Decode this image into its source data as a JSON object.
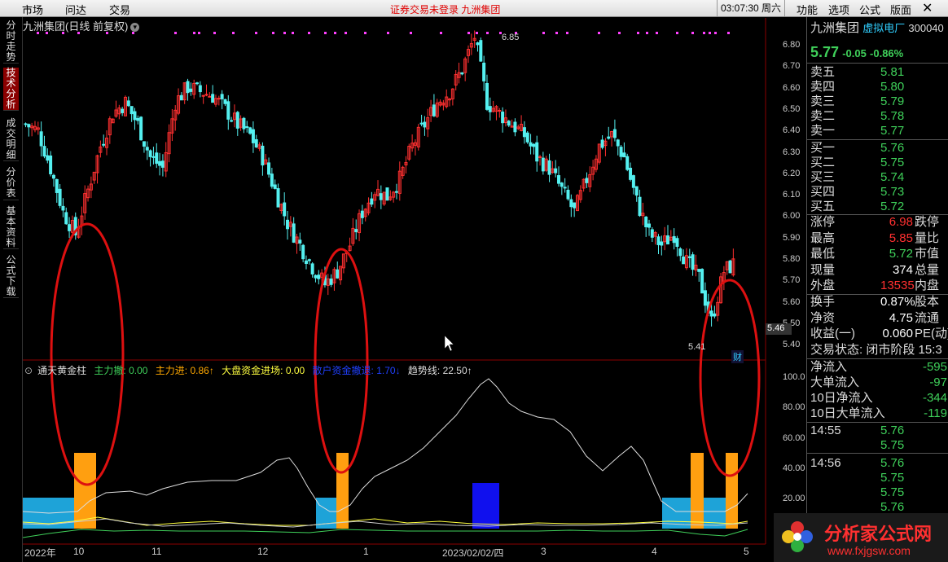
{
  "menu": {
    "items": [
      "市场",
      "问达",
      "交易"
    ],
    "title": "证券交易未登录  九洲集团",
    "clock": "03:07:30 周六",
    "right_items": [
      "功能",
      "选项",
      "公式",
      "版面"
    ],
    "close": "✕"
  },
  "left_tabs": [
    "分时走势",
    "技术分析",
    "成交明细",
    "分价表",
    "基本资料",
    "公式下载"
  ],
  "chart": {
    "title": "九洲集团(日线 前复权)",
    "price_ticks": [
      "6.80",
      "6.70",
      "6.60",
      "6.50",
      "6.40",
      "6.30",
      "6.20",
      "6.10",
      "6.00",
      "5.90",
      "5.80",
      "5.70",
      "5.60",
      "5.50",
      "5.40"
    ],
    "current_price_label": "5.46",
    "high_marker": "6.85",
    "low_marker": "5.41",
    "fin_badge": "财",
    "indicator_ticks": [
      "100.0",
      "80.00",
      "60.00",
      "40.00",
      "20.00"
    ],
    "time_ticks": [
      "2022年",
      "10",
      "11",
      "12",
      "1",
      "2023/02/02/四",
      "3",
      "4",
      "5"
    ]
  },
  "indicator": {
    "name": "通天黄金柱",
    "items": [
      {
        "label": "主力撤: 0.00",
        "color": "#3fd05a"
      },
      {
        "label": "主力进: 0.86↑",
        "color": "#ffa800"
      },
      {
        "label": "大盘资金进场: 0.00",
        "color": "#ffff40"
      },
      {
        "label": "散户资金撤退: 1.70↓",
        "color": "#2040ff"
      },
      {
        "label": "趋势线: 22.50↑",
        "color": "#dddddd"
      }
    ]
  },
  "chart_data": {
    "type": "candlestick",
    "price_ylim": [
      5.4,
      6.85
    ],
    "indicator_ylim": [
      0,
      100
    ],
    "candles_approx_close": [
      6.45,
      6.42,
      6.25,
      6.05,
      5.95,
      6.15,
      6.35,
      6.5,
      6.55,
      6.45,
      6.3,
      6.25,
      6.55,
      6.62,
      6.6,
      6.58,
      6.52,
      6.45,
      6.4,
      6.3,
      6.15,
      6.0,
      5.9,
      5.8,
      5.72,
      5.78,
      5.9,
      6.05,
      6.15,
      6.12,
      6.2,
      6.35,
      6.45,
      6.55,
      6.6,
      6.7,
      6.85,
      6.55,
      6.5,
      6.45,
      6.4,
      6.3,
      6.25,
      6.15,
      6.05,
      6.2,
      6.35,
      6.4,
      6.3,
      6.1,
      5.95,
      5.9,
      5.95,
      5.82,
      5.75,
      5.55,
      5.78,
      5.82
    ]
  },
  "quote": {
    "name": "九洲集团",
    "tag": "虚拟电厂",
    "code": "300040",
    "price": "5.77",
    "change": "-0.05",
    "change_pct": "-0.86%",
    "asks": [
      {
        "label": "卖五",
        "price": "5.81"
      },
      {
        "label": "卖四",
        "price": "5.80"
      },
      {
        "label": "卖三",
        "price": "5.79"
      },
      {
        "label": "卖二",
        "price": "5.78"
      },
      {
        "label": "卖一",
        "price": "5.77"
      }
    ],
    "bids": [
      {
        "label": "买一",
        "price": "5.76"
      },
      {
        "label": "买二",
        "price": "5.75"
      },
      {
        "label": "买三",
        "price": "5.74"
      },
      {
        "label": "买四",
        "price": "5.73"
      },
      {
        "label": "买五",
        "price": "5.72"
      }
    ],
    "stats": [
      {
        "l": "涨停",
        "v": "6.98",
        "r": "跌停",
        "c": "red"
      },
      {
        "l": "最高",
        "v": "5.85",
        "r": "量比",
        "c": "red"
      },
      {
        "l": "最低",
        "v": "5.72",
        "r": "市值",
        "c": "green"
      },
      {
        "l": "现量",
        "v": "374",
        "r": "总量",
        "c": "white"
      },
      {
        "l": "外盘",
        "v": "13535",
        "r": "内盘",
        "c": "red"
      }
    ],
    "stats2": [
      {
        "l": "换手",
        "v": "0.87%",
        "r": "股本"
      },
      {
        "l": "净资",
        "v": "4.75",
        "r": "流通"
      },
      {
        "l": "收益(一)",
        "v": "0.060",
        "r": "PE(动)"
      }
    ],
    "status": "交易状态: 闭市阶段 15:3",
    "flows": [
      {
        "l": "净流入",
        "v": "-595"
      },
      {
        "l": "大单流入",
        "v": "-97"
      },
      {
        "l": "10日净流入",
        "v": "-344"
      },
      {
        "l": "10日大单流入",
        "v": "-119"
      }
    ],
    "ticks": [
      {
        "time": "14:55",
        "p1": "5.76",
        "p2": "5.75"
      },
      {
        "time": "14:56",
        "p1": "5.76",
        "p2": "5.75",
        "p3": "5.75",
        "p4": "5.76"
      }
    ]
  },
  "logo": {
    "text": "分析家公式网",
    "url_text": "www.fxjgsw.com"
  }
}
